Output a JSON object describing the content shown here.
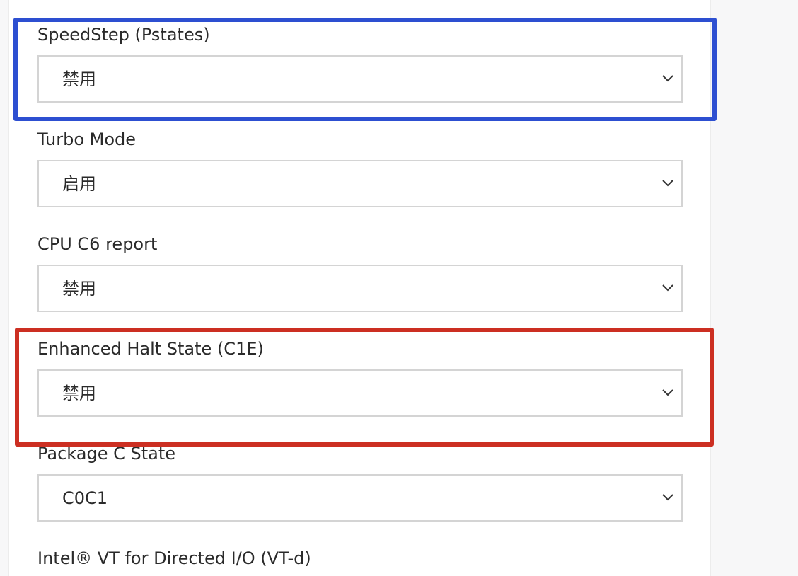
{
  "settings": [
    {
      "label": "SpeedStep (Pstates)",
      "value": "禁用"
    },
    {
      "label": "Turbo Mode",
      "value": "启用"
    },
    {
      "label": "CPU C6 report",
      "value": "禁用"
    },
    {
      "label": "Enhanced Halt State (C1E)",
      "value": "禁用"
    },
    {
      "label": "Package C State",
      "value": "C0C1"
    },
    {
      "label": "Intel® VT for Directed I/O (VT-d)"
    }
  ],
  "colors": {
    "highlight_blue": "#2d4fd1",
    "highlight_red": "#cc2f22",
    "text": "#2a2a2a",
    "select_border": "#d4d4d4"
  },
  "icons": {
    "dropdown": "chevron-down-icon"
  }
}
